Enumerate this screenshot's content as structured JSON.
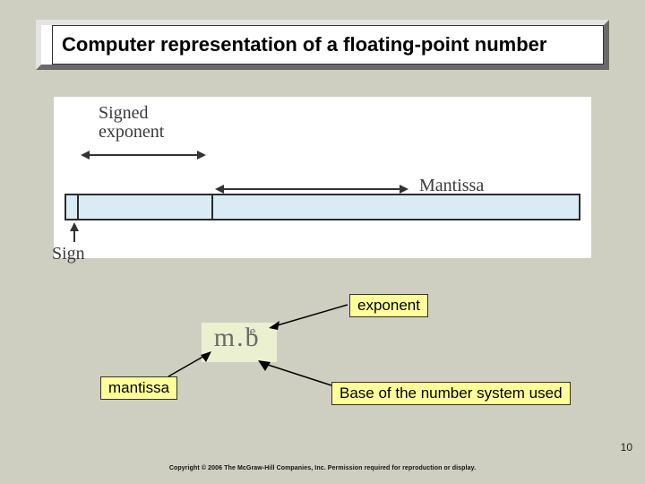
{
  "title": "Computer representation of a floating-point number",
  "figure": {
    "signed_exponent_label": "Signed\nexponent",
    "mantissa_label": "Mantissa",
    "sign_label": "Sign"
  },
  "formula": {
    "m": "m",
    "dot": ".",
    "b": "b",
    "e": "e"
  },
  "annotations": {
    "exponent": "exponent",
    "mantissa": "mantissa",
    "base": "Base of the number system used"
  },
  "slide_number": "10",
  "copyright": "Copyright © 2006 The McGraw-Hill Companies, Inc. Permission required for reproduction or display."
}
